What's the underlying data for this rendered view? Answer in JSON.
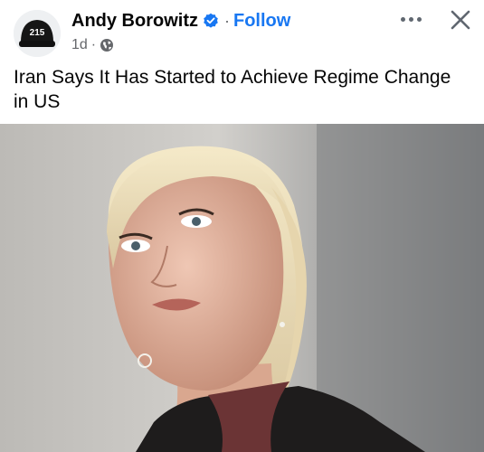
{
  "post": {
    "author": "Andy Borowitz",
    "separator": "·",
    "follow_label": "Follow",
    "age": "1d",
    "meta_separator": "·",
    "text": "Iran Says It Has Started to Achieve Regime Change in US"
  },
  "avatar": {
    "hat_text": "215"
  },
  "icons": {
    "verified": "verified-badge-icon",
    "globe": "globe-icon",
    "more": "more-options-icon",
    "close": "close-icon"
  },
  "colors": {
    "accent": "#1877f2",
    "text_primary": "#050505",
    "text_secondary": "#65676b"
  },
  "image": {
    "subject": "photo"
  }
}
